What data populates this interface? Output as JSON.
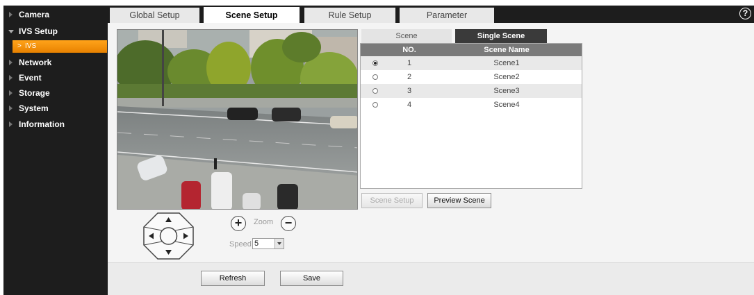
{
  "sidebar": {
    "items": [
      {
        "label": "Camera",
        "expanded": false
      },
      {
        "label": "IVS Setup",
        "expanded": true,
        "children": [
          {
            "label": "IVS",
            "selected": true
          }
        ]
      },
      {
        "label": "Network",
        "expanded": false
      },
      {
        "label": "Event",
        "expanded": false
      },
      {
        "label": "Storage",
        "expanded": false
      },
      {
        "label": "System",
        "expanded": false
      },
      {
        "label": "Information",
        "expanded": false
      }
    ]
  },
  "tabs": [
    {
      "label": "Global Setup",
      "active": false
    },
    {
      "label": "Scene Setup",
      "active": true
    },
    {
      "label": "Rule Setup",
      "active": false
    },
    {
      "label": "Parameter",
      "active": false
    }
  ],
  "help_icon": "question-circle-icon",
  "scene_panel": {
    "tabs": [
      {
        "label": "Scene",
        "active": false
      },
      {
        "label": "Single Scene",
        "active": true
      }
    ],
    "columns": {
      "no": "NO.",
      "name": "Scene Name"
    },
    "rows": [
      {
        "no": "1",
        "name": "Scene1",
        "selected": true
      },
      {
        "no": "2",
        "name": "Scene2",
        "selected": false
      },
      {
        "no": "3",
        "name": "Scene3",
        "selected": false
      },
      {
        "no": "4",
        "name": "Scene4",
        "selected": false
      }
    ],
    "scene_setup_label": "Scene Setup",
    "preview_scene_label": "Preview Scene"
  },
  "ptz": {
    "zoom_in": "+",
    "zoom_label": "Zoom",
    "zoom_out": "−",
    "speed_label": "Speed",
    "speed_value": "5"
  },
  "footer": {
    "refresh_label": "Refresh",
    "save_label": "Save"
  },
  "colors": {
    "accent": "#f29410",
    "header_bg": "#1d1d1d",
    "content_bg": "#f4f4f4"
  }
}
